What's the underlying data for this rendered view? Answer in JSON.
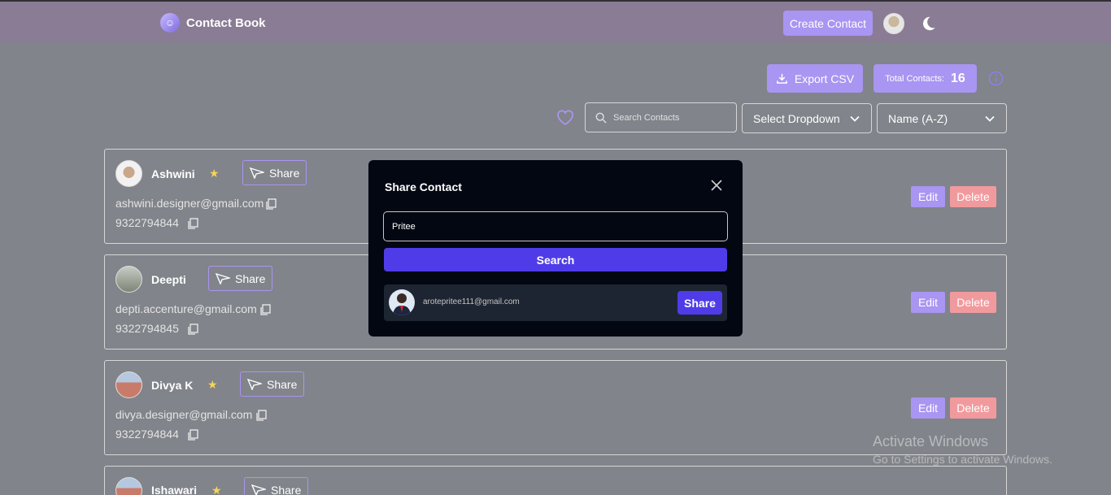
{
  "app": {
    "title": "Contact Book",
    "logo_icon": "contact-book-logo-icon"
  },
  "header": {
    "create_label": "Create Contact",
    "theme_icon": "moon-icon"
  },
  "toolbar": {
    "export_label": "Export CSV",
    "total_label": "Total Contacts:",
    "total_count": "16",
    "search_placeholder": "Search Contacts",
    "filter_dropdown": "Select Dropdown",
    "sort_dropdown": "Name (A-Z)"
  },
  "contacts": [
    {
      "name": "Ashwini",
      "starred": true,
      "email": "ashwini.designer@gmail.com",
      "phone": "9322794844",
      "share_label": "Share",
      "edit_label": "Edit",
      "delete_label": "Delete"
    },
    {
      "name": "Deepti",
      "starred": false,
      "email": "depti.accenture@gmail.com",
      "phone": "9322794845",
      "share_label": "Share",
      "edit_label": "Edit",
      "delete_label": "Delete"
    },
    {
      "name": "Divya K",
      "starred": true,
      "email": "divya.designer@gmail.com",
      "phone": "9322794844",
      "share_label": "Share",
      "edit_label": "Edit",
      "delete_label": "Delete"
    },
    {
      "name": "Ishawari",
      "starred": true,
      "share_label": "Share"
    }
  ],
  "modal": {
    "title": "Share Contact",
    "search_value": "Pritee",
    "search_button": "Search",
    "result": {
      "email": "arotepritee111@gmail.com",
      "share_label": "Share"
    }
  },
  "watermark": {
    "line1": "Activate Windows",
    "line2": "Go to Settings to activate Windows."
  },
  "colors": {
    "accent": "#a995f2",
    "primary": "#4f3ce8",
    "danger": "#f19a9d",
    "star": "#f4d45c",
    "modal_bg": "#030712"
  }
}
